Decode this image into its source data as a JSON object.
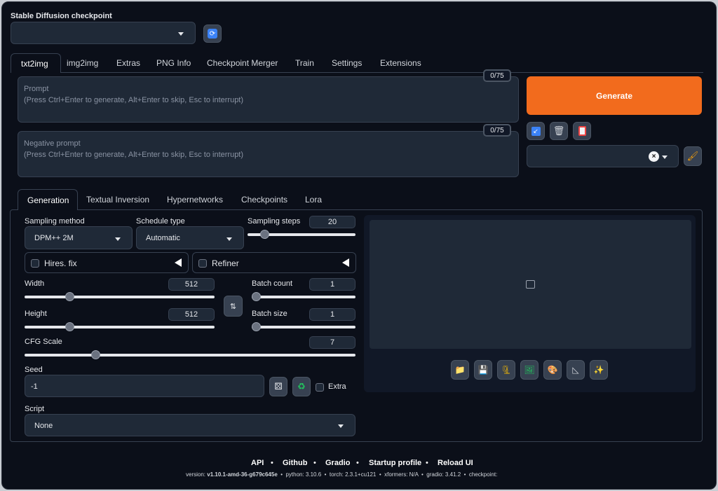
{
  "checkpoint": {
    "label": "Stable Diffusion checkpoint",
    "value": ""
  },
  "main_tabs": [
    "txt2img",
    "img2img",
    "Extras",
    "PNG Info",
    "Checkpoint Merger",
    "Train",
    "Settings",
    "Extensions"
  ],
  "prompt": {
    "label": "Prompt",
    "placeholder": "(Press Ctrl+Enter to generate, Alt+Enter to skip, Esc to interrupt)",
    "counter": "0/75"
  },
  "negative_prompt": {
    "label": "Negative prompt",
    "placeholder": "(Press Ctrl+Enter to generate, Alt+Enter to skip, Esc to interrupt)",
    "counter": "0/75"
  },
  "generate_label": "Generate",
  "styles_value": "",
  "sub_tabs": [
    "Generation",
    "Textual Inversion",
    "Hypernetworks",
    "Checkpoints",
    "Lora"
  ],
  "sampling_method": {
    "label": "Sampling method",
    "value": "DPM++ 2M"
  },
  "schedule_type": {
    "label": "Schedule type",
    "value": "Automatic"
  },
  "sampling_steps": {
    "label": "Sampling steps",
    "value": "20",
    "min": 1,
    "max": 150
  },
  "hires_fix": {
    "label": "Hires. fix"
  },
  "refiner": {
    "label": "Refiner"
  },
  "width": {
    "label": "Width",
    "value": "512",
    "min": 64,
    "max": 2048
  },
  "height": {
    "label": "Height",
    "value": "512",
    "min": 64,
    "max": 2048
  },
  "batch_count": {
    "label": "Batch count",
    "value": "1",
    "min": 1,
    "max": 100
  },
  "batch_size": {
    "label": "Batch size",
    "value": "1",
    "min": 1,
    "max": 8
  },
  "cfg_scale": {
    "label": "CFG Scale",
    "value": "7",
    "min": 1,
    "max": 30
  },
  "seed": {
    "label": "Seed",
    "value": "-1",
    "extra_label": "Extra"
  },
  "script": {
    "label": "Script",
    "value": "None"
  },
  "footer": {
    "links": [
      "API",
      "Github",
      "Gradio",
      "Startup profile",
      "Reload UI"
    ],
    "version_label": "version:",
    "version_value": "v1.10.1-amd-36-g679c645e",
    "python": "python: 3.10.6",
    "torch": "torch: 2.3.1+cu121",
    "xformers": "xformers: N/A",
    "gradio": "gradio: 3.41.2",
    "checkpoint": "checkpoint:"
  },
  "colors": {
    "generate": "#f26b1d",
    "background": "#0b0f19",
    "field": "#1f2937"
  }
}
